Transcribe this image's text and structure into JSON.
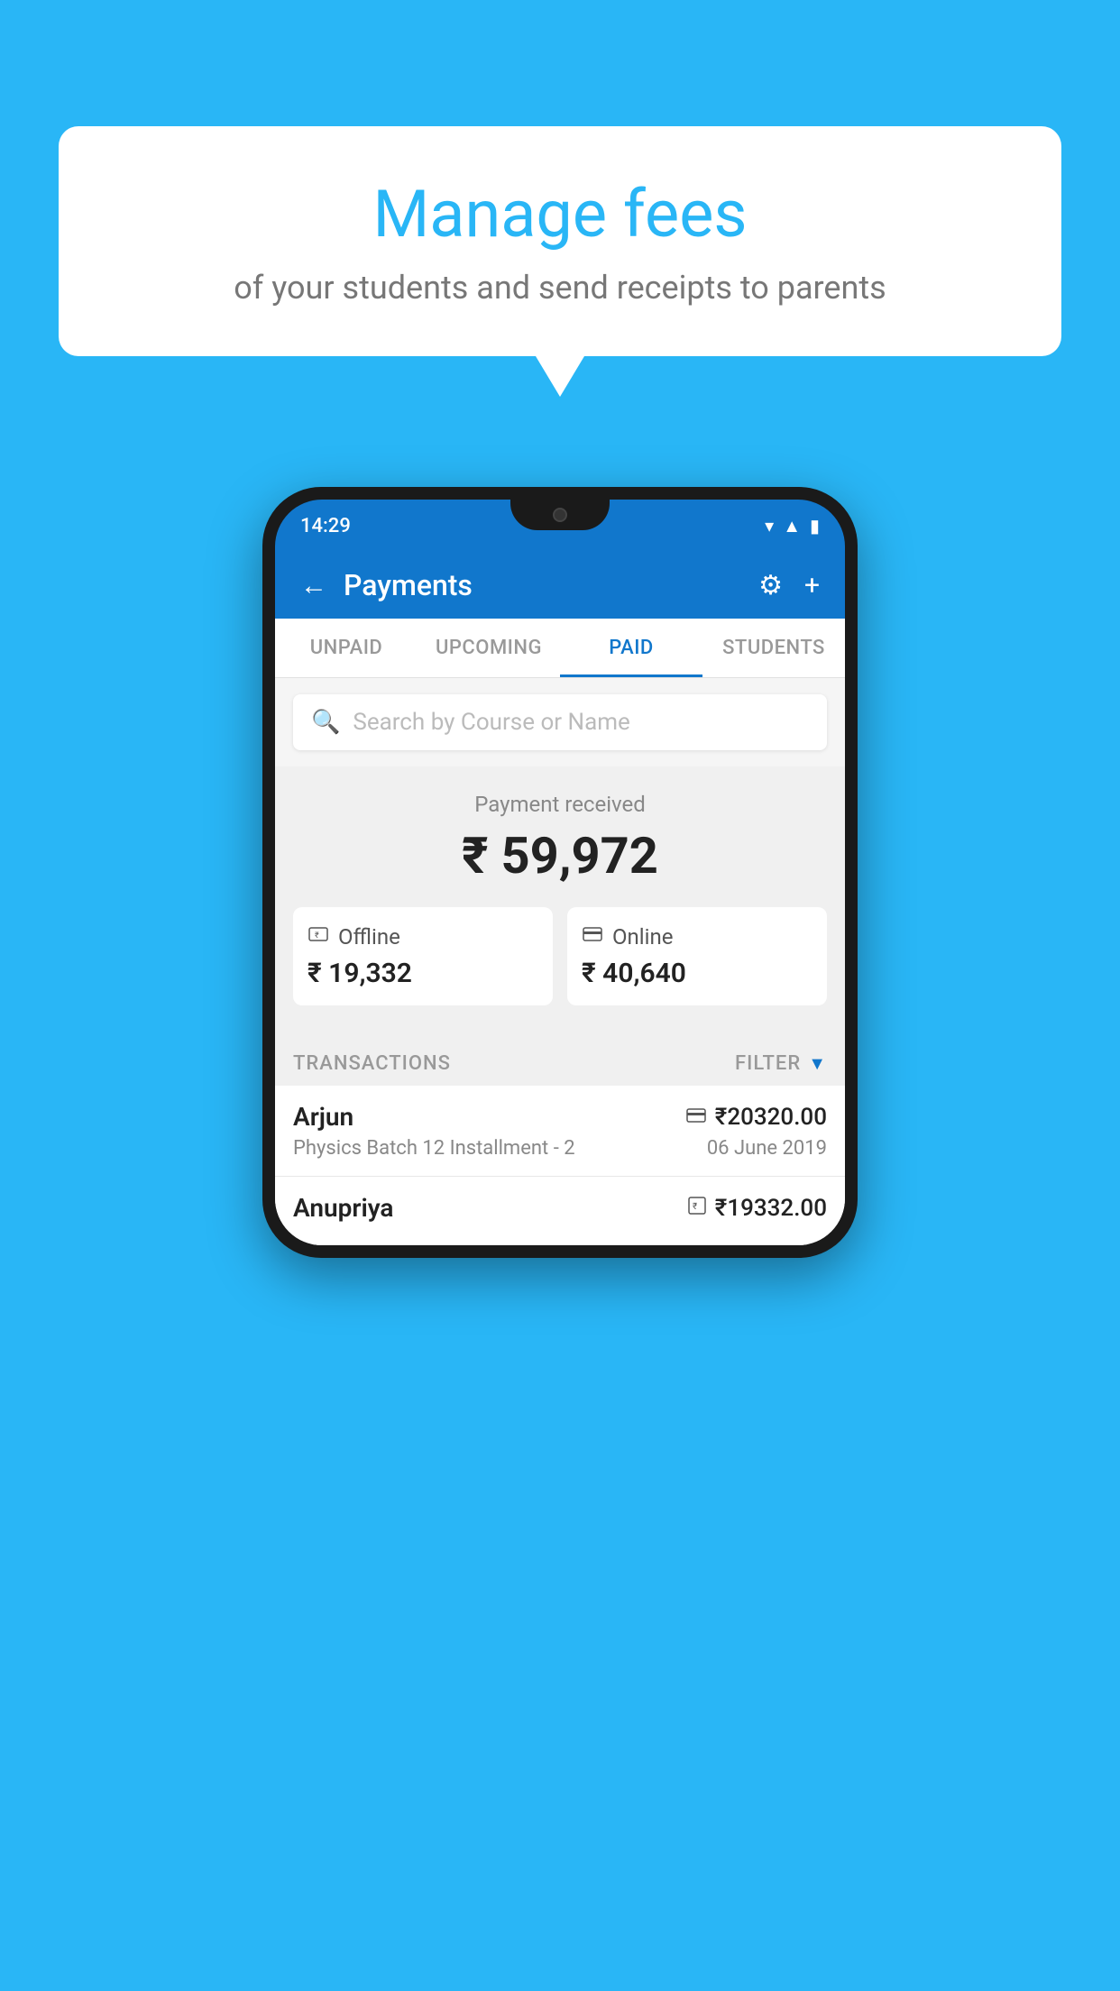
{
  "background_color": "#29b6f6",
  "speech_bubble": {
    "title": "Manage fees",
    "subtitle": "of your students and send receipts to parents"
  },
  "phone": {
    "status_bar": {
      "time": "14:29",
      "icons": [
        "wifi",
        "signal",
        "battery"
      ]
    },
    "header": {
      "title": "Payments",
      "back_label": "←",
      "settings_label": "⚙",
      "add_label": "+"
    },
    "tabs": [
      {
        "label": "UNPAID",
        "active": false
      },
      {
        "label": "UPCOMING",
        "active": false
      },
      {
        "label": "PAID",
        "active": true
      },
      {
        "label": "STUDENTS",
        "active": false
      }
    ],
    "search": {
      "placeholder": "Search by Course or Name"
    },
    "payment_received": {
      "label": "Payment received",
      "amount": "₹ 59,972",
      "offline": {
        "icon": "💳",
        "label": "Offline",
        "amount": "₹ 19,332"
      },
      "online": {
        "icon": "💳",
        "label": "Online",
        "amount": "₹ 40,640"
      }
    },
    "transactions": {
      "header_label": "TRANSACTIONS",
      "filter_label": "FILTER",
      "items": [
        {
          "name": "Arjun",
          "detail": "Physics Batch 12 Installment - 2",
          "amount": "₹20320.00",
          "date": "06 June 2019",
          "icon": "card"
        },
        {
          "name": "Anupriya",
          "detail": "",
          "amount": "₹19332.00",
          "date": "",
          "icon": "rupee"
        }
      ]
    }
  }
}
